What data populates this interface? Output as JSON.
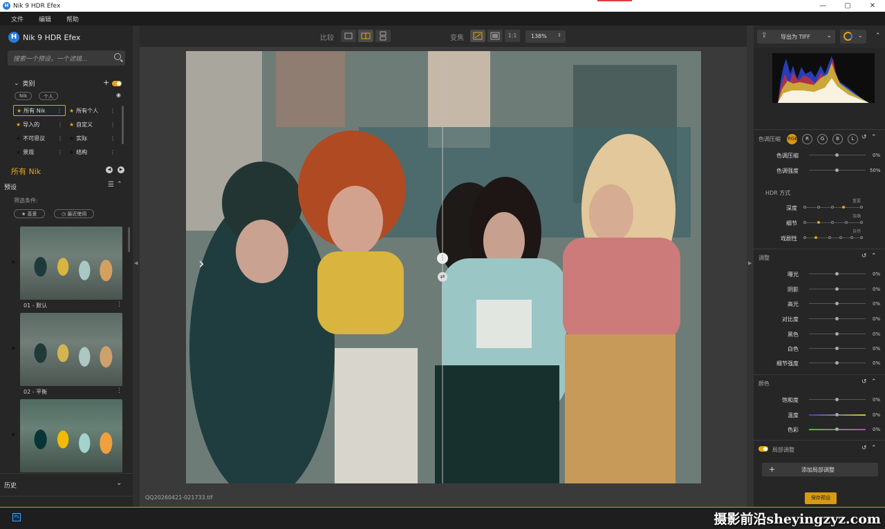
{
  "window": {
    "title": "Nik 9 HDR Efex",
    "min": "—",
    "max": "▢",
    "close": "✕"
  },
  "menu": [
    "文件",
    "编辑",
    "帮助"
  ],
  "left": {
    "app_name": "Nik 9 HDR Efex",
    "search_placeholder": "搜索一个预设，一个滤镜...",
    "categories_title": "类别",
    "chips": [
      "Nik",
      "个人"
    ],
    "cat_items": [
      {
        "label": "所有 Nik",
        "star": "gold"
      },
      {
        "label": "所有个人",
        "star": "gold"
      },
      {
        "label": "导入的",
        "star": "gold"
      },
      {
        "label": "自定义",
        "star": "gold"
      },
      {
        "label": "不可思议",
        "star": "dark"
      },
      {
        "label": "实际",
        "star": "dark"
      },
      {
        "label": "景观",
        "star": "dark"
      },
      {
        "label": "结构",
        "star": "dark"
      }
    ],
    "current_collection": "所有 Nik",
    "presets_title": "预设",
    "filter_label": "筛选条件:",
    "filter_chips": [
      "★ 喜爱",
      "◷ 最近使用"
    ],
    "presets": [
      {
        "label": "01 - 默认"
      },
      {
        "label": "02 - 平衡"
      },
      {
        "label": ""
      }
    ],
    "history_title": "历史"
  },
  "toolbar": {
    "compare_label": "比较",
    "zoom_label": "变焦",
    "one_to_one": "1:1",
    "zoom_value": "138%"
  },
  "filename": "QQ20260421-021733.tif",
  "right": {
    "export_label": "导出为 TIFF",
    "channels": [
      "RGB",
      "R",
      "G",
      "B",
      "L"
    ],
    "tone_section": "色调压缩",
    "tone_rows": [
      {
        "label": "色调压缩",
        "value": "0%"
      },
      {
        "label": "色调强度",
        "value": "50%"
      }
    ],
    "hdr_mode_title": "HDR 方式",
    "hdr_rows": [
      {
        "label": "深度",
        "caption": "重要"
      },
      {
        "label": "细节",
        "caption": "准确"
      },
      {
        "label": "戏剧性",
        "caption": "自然"
      }
    ],
    "light_section": "调整",
    "light_rows": [
      {
        "label": "曝光",
        "value": "0%"
      },
      {
        "label": "阴影",
        "value": "0%"
      },
      {
        "label": "高光",
        "value": "0%"
      },
      {
        "label": "对比度",
        "value": "0%"
      },
      {
        "label": "黑色",
        "value": "0%"
      },
      {
        "label": "白色",
        "value": "0%"
      },
      {
        "label": "细节强度",
        "value": "0%"
      }
    ],
    "color_section": "颜色",
    "color_rows": [
      {
        "label": "饱和度",
        "value": "0%"
      },
      {
        "label": "温度",
        "value": "0%"
      },
      {
        "label": "色彩",
        "value": "0%"
      }
    ],
    "local_section": "局部调整",
    "add_local": "添加局部调整",
    "save_preset": "保存预设"
  },
  "bottom": {
    "watermark": "摄影前沿sheyingzyz.com"
  }
}
